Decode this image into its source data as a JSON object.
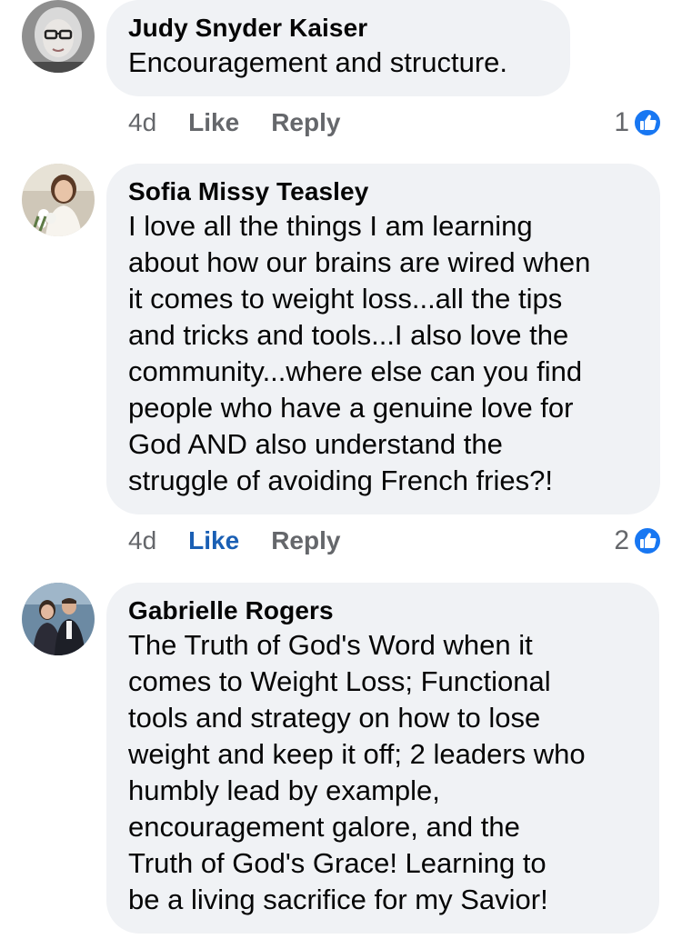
{
  "comments": [
    {
      "author": "Judy Snyder Kaiser",
      "text": "Encouragement and structure.",
      "time": "4d",
      "like_label": "Like",
      "reply_label": "Reply",
      "reaction_count": "1",
      "reaction_icon": "thumbs-up-icon",
      "liked": false
    },
    {
      "author": "Sofia Missy Teasley",
      "text": "I love all the things I am learning\nabout how our brains are wired when\nit comes to weight loss...all the tips\nand tricks and tools...I also love the\ncommunity...where else can you find\npeople who have a genuine love for\nGod AND also understand the\nstruggle of avoiding French fries?!",
      "time": "4d",
      "like_label": "Like",
      "reply_label": "Reply",
      "reaction_count": "2",
      "reaction_icon": "thumbs-up-icon",
      "liked": true
    },
    {
      "author": "Gabrielle Rogers",
      "text": "The Truth of God's Word when it\ncomes to Weight Loss; Functional\ntools and strategy on how to lose\nweight and keep it off; 2 leaders who\nhumbly lead by example,\nencouragement galore, and the\nTruth of God's Grace!  Learning to\nbe a living sacrifice for my Savior!"
    }
  ],
  "colors": {
    "bubble": "#f0f2f5",
    "action_text": "#65676b",
    "liked": "#1a5fb4",
    "reaction_blue": "#1877f2"
  }
}
